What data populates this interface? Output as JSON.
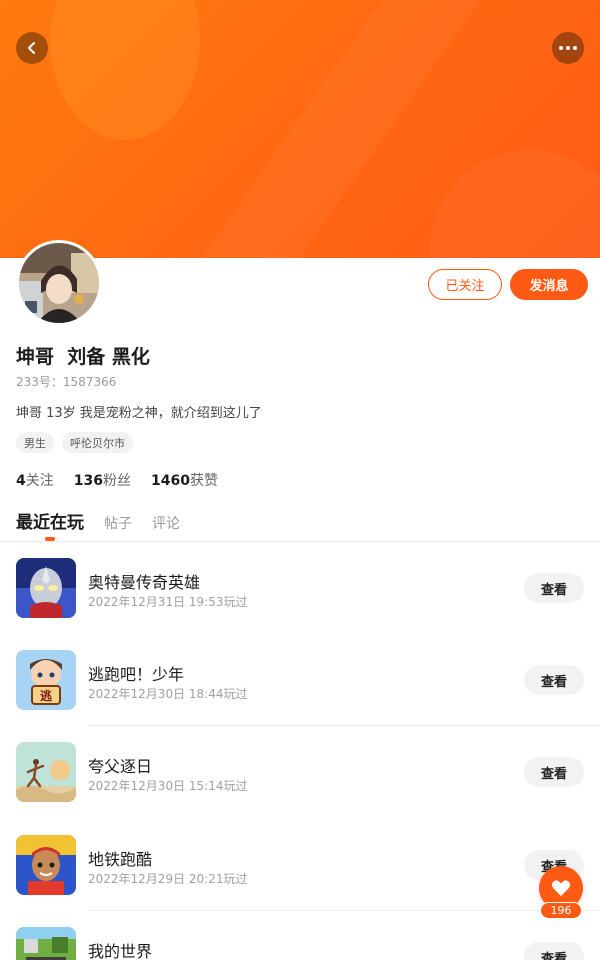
{
  "header": {
    "back_icon": "chevron-left-icon",
    "more_icon": "more-dots-icon",
    "banner_color": "#ff6a12"
  },
  "profile": {
    "name": "坤哥  刘备 黑化",
    "uid": "233号：1587366",
    "bio": "坤哥 13岁 我是宠粉之神，就介绍到这儿了",
    "tags": [
      "男生",
      "呼伦贝尔市"
    ],
    "follow_button": "已关注",
    "message_button": "发消息",
    "accent_color": "#ff5a14"
  },
  "stats": [
    {
      "value": "4",
      "label": "关注"
    },
    {
      "value": "136",
      "label": "粉丝"
    },
    {
      "value": "1460",
      "label": "获赞"
    }
  ],
  "tabs": [
    "最近在玩",
    "帖子",
    "评论"
  ],
  "active_tab": "最近在玩",
  "games": [
    {
      "title": "奥特曼传奇英雄",
      "time": "2022年12月31日 19:53玩过",
      "action": "查看"
    },
    {
      "title": "逃跑吧！少年",
      "time": "2022年12月30日 18:44玩过",
      "action": "查看"
    },
    {
      "title": "夸父逐日",
      "time": "2022年12月30日 15:14玩过",
      "action": "查看"
    },
    {
      "title": "地铁跑酷",
      "time": "2022年12月29日 20:21玩过",
      "action": "查看"
    },
    {
      "title": "我的世界",
      "time": "",
      "action": "查看"
    }
  ],
  "fab": {
    "icon": "heart-icon",
    "count": "196"
  }
}
